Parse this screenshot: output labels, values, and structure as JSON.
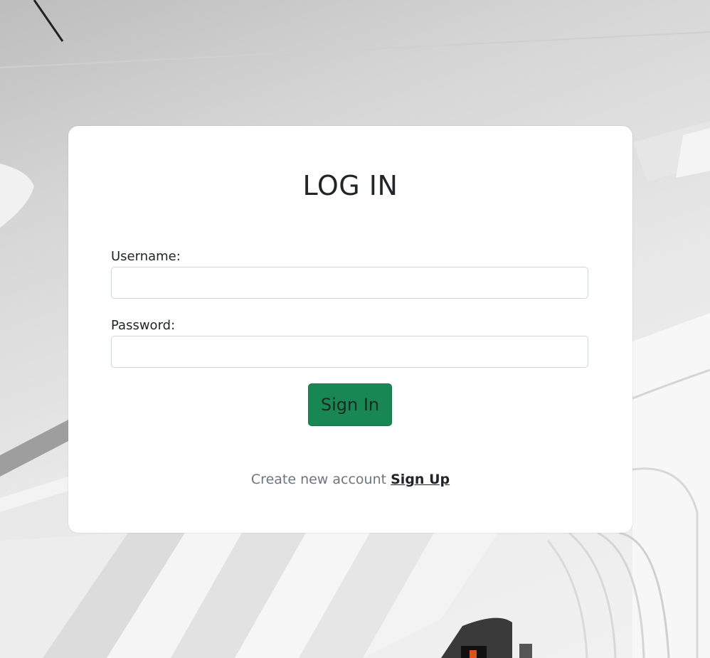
{
  "login": {
    "title": "LOG IN",
    "username_label": "Username:",
    "username_value": "",
    "password_label": "Password:",
    "password_value": "",
    "signin_label": "Sign In",
    "footer_text": "Create new account",
    "signup_label": "Sign Up"
  },
  "colors": {
    "button": "#198754",
    "card": "#ffffff",
    "muted_text": "#6c757d"
  }
}
